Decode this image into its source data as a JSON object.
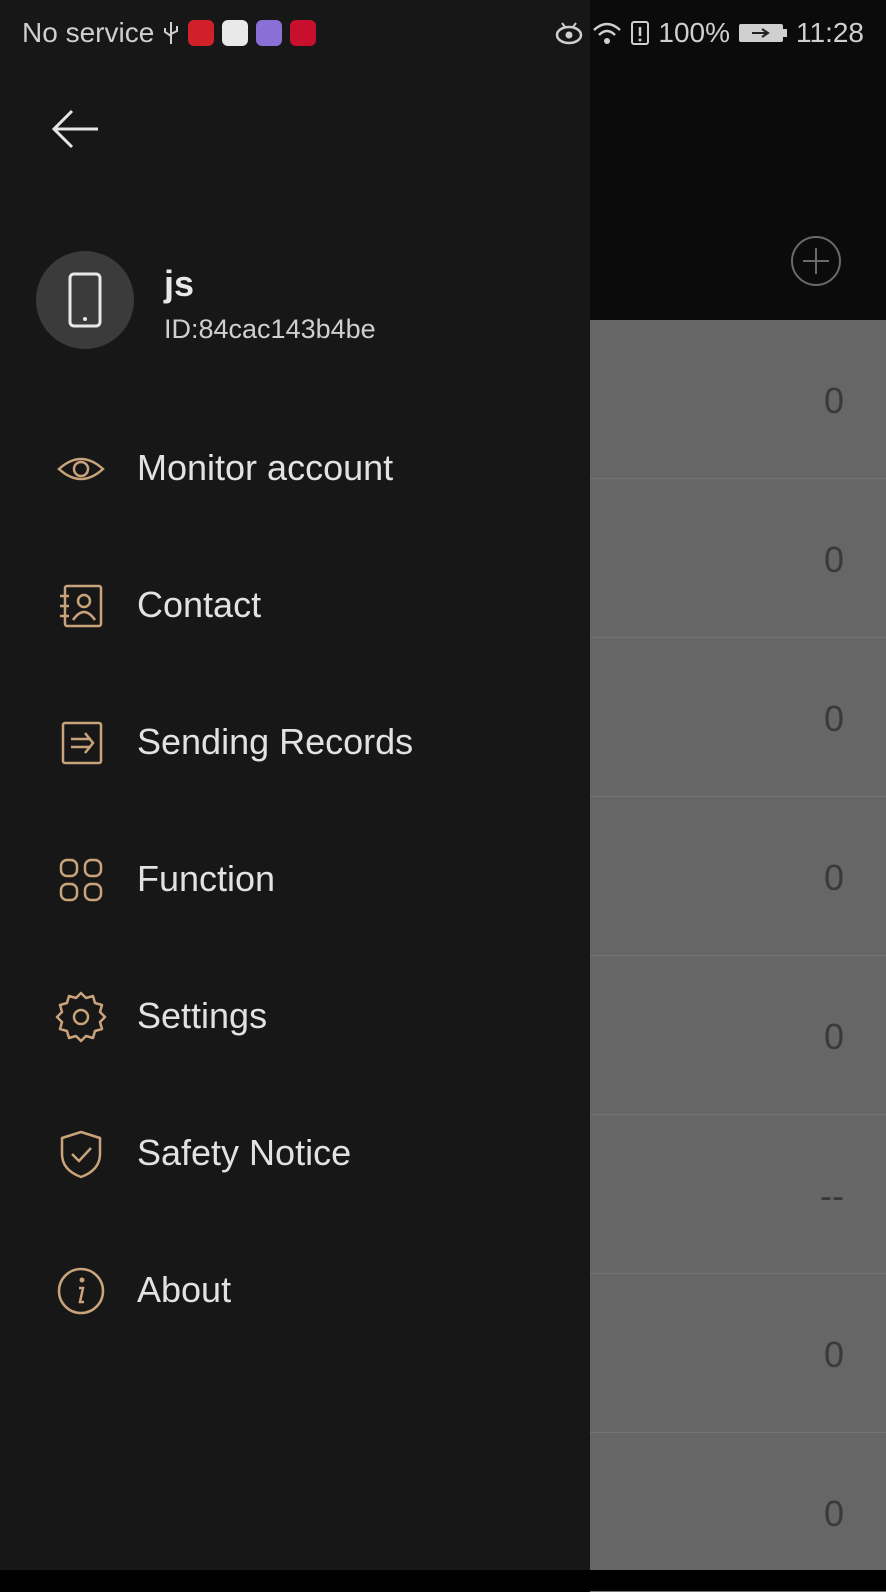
{
  "status_bar": {
    "carrier": "No service",
    "battery": "100%",
    "time": "11:28",
    "colors": {
      "toutiao": "#d0202a",
      "app2": "#e9e9e9",
      "app3": "#8a6fd6",
      "huawei": "#c8102e"
    }
  },
  "drawer": {
    "user": {
      "name": "js",
      "id": "ID:84cac143b4be",
      "avatar_icon": "phone-icon"
    },
    "menu": [
      {
        "label": "Monitor account",
        "icon": "eye-icon"
      },
      {
        "label": "Contact",
        "icon": "contact-card-icon"
      },
      {
        "label": "Sending Records",
        "icon": "send-record-icon"
      },
      {
        "label": "Function",
        "icon": "grid-icon"
      },
      {
        "label": "Settings",
        "icon": "gear-icon"
      },
      {
        "label": "Safety Notice",
        "icon": "shield-check-icon"
      },
      {
        "label": "About",
        "icon": "info-icon"
      }
    ],
    "accent": "#c9a37a"
  },
  "background_list": {
    "values": [
      "0",
      "0",
      "0",
      "0",
      "0",
      "--",
      "0",
      "0"
    ]
  }
}
